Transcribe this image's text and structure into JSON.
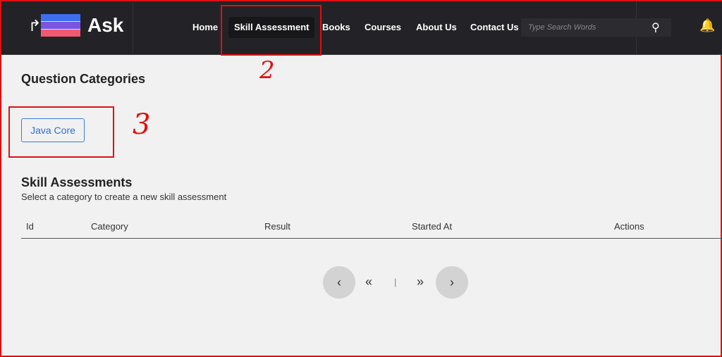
{
  "header": {
    "logo_text": "Ask",
    "logo_colors": [
      "#3b6ff0",
      "#7a55e0",
      "#f05a70"
    ],
    "nav": [
      {
        "label": "Home"
      },
      {
        "label": "Skill Assessment",
        "active": true
      },
      {
        "label": "Books"
      },
      {
        "label": "Courses"
      },
      {
        "label": "About Us"
      },
      {
        "label": "Contact Us"
      }
    ],
    "search_placeholder": "Type Search Words",
    "search_icon": "search-icon",
    "notification_icon": "bell-icon"
  },
  "categories": {
    "title": "Question Categories",
    "items": [
      {
        "label": "Java Core"
      }
    ]
  },
  "assessments": {
    "title": "Skill Assessments",
    "subtitle": "Select a category to create a new skill assessment",
    "columns": [
      "Id",
      "Category",
      "Result",
      "Started At",
      "Actions"
    ],
    "rows": []
  },
  "pagination": {
    "prev": "‹",
    "first": "«",
    "separator": "|",
    "last": "»",
    "next": "›"
  },
  "annotations": {
    "label_2": "2",
    "label_3": "3",
    "color": "#e01010"
  }
}
